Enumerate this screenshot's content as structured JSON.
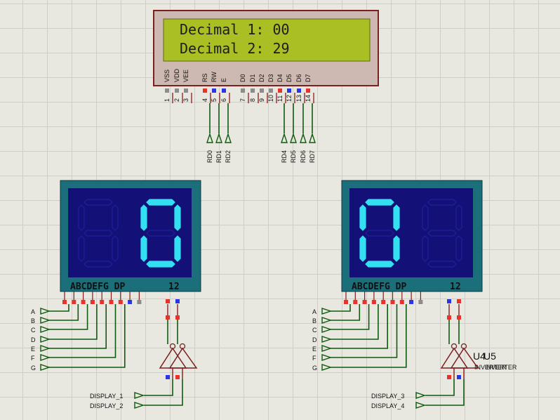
{
  "lcd": {
    "lines": [
      "Decimal 1: 00",
      "Decimal 2: 29"
    ],
    "pin_names": [
      "VSS",
      "VDD",
      "VEE",
      "RS",
      "RW",
      "E",
      "D0",
      "D1",
      "D2",
      "D3",
      "D4",
      "D5",
      "D6",
      "D7"
    ],
    "pin_numbers": [
      "1",
      "2",
      "3",
      "4",
      "5",
      "6",
      "7",
      "8",
      "9",
      "10",
      "11",
      "12",
      "13",
      "14"
    ]
  },
  "lcd_terminals": [
    "RD0",
    "RD1",
    "RD2",
    "RD4",
    "RD5",
    "RD6",
    "RD7"
  ],
  "display_left": {
    "digits": [
      "",
      "0"
    ],
    "pin_label": "ABCDEFG DP",
    "common_label": "12",
    "segment_inputs": [
      "A",
      "B",
      "C",
      "D",
      "E",
      "F",
      "G"
    ],
    "controls": [
      "DISPLAY_1",
      "DISPLAY_2"
    ]
  },
  "display_right": {
    "digits": [
      "0",
      ""
    ],
    "pin_label": "ABCDEFG DP",
    "common_label": "12",
    "segment_inputs": [
      "A",
      "B",
      "C",
      "D",
      "E",
      "F",
      "G"
    ],
    "controls": [
      "DISPLAY_3",
      "DISPLAY_4"
    ],
    "inverter_refs": [
      "U4",
      "U5"
    ],
    "inverter_type": "INVERTER"
  },
  "colors": {
    "lcd_screen": "#aabf24",
    "lcd_frame": "#cdb9b1",
    "display_body": "#1a6f7a",
    "display_face": "#131177",
    "segment_on": "#33e0f2",
    "segment_off": "#1d229a",
    "wire": "#0f5a0f",
    "pin_red": "#e8322a",
    "pin_blue": "#2a35e8",
    "pin_gray": "#8c8c8c"
  }
}
